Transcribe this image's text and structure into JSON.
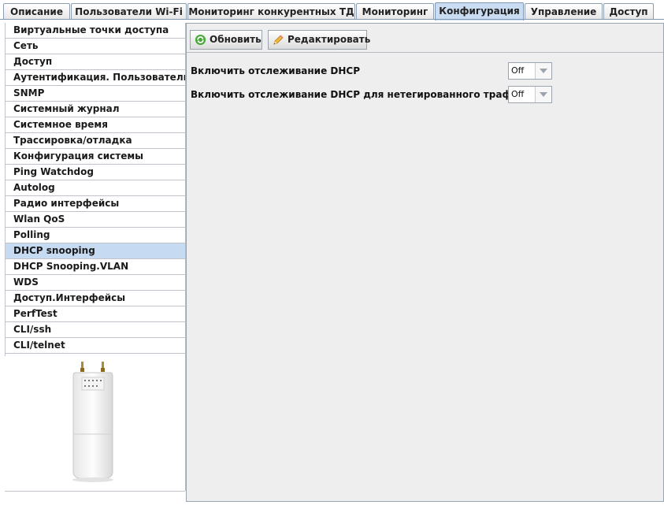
{
  "tabs": [
    {
      "label": "Описание",
      "active": false
    },
    {
      "label": "Пользователи Wi-Fi",
      "active": false
    },
    {
      "label": "Мониторинг конкурентных ТД",
      "active": false
    },
    {
      "label": "Мониторинг",
      "active": false
    },
    {
      "label": "Конфигурация",
      "active": true
    },
    {
      "label": "Управление",
      "active": false
    },
    {
      "label": "Доступ",
      "active": false
    }
  ],
  "sidebar": {
    "items": [
      {
        "label": "Виртуальные точки доступа"
      },
      {
        "label": "Сеть"
      },
      {
        "label": "Доступ"
      },
      {
        "label": "Аутентификация. Пользователи"
      },
      {
        "label": "SNMP"
      },
      {
        "label": "Системный журнал"
      },
      {
        "label": "Системное время"
      },
      {
        "label": "Трассировка/отладка"
      },
      {
        "label": "Конфигурация системы"
      },
      {
        "label": "Ping Watchdog"
      },
      {
        "label": "Autolog"
      },
      {
        "label": "Радио интерфейсы"
      },
      {
        "label": "Wlan QoS"
      },
      {
        "label": "Polling"
      },
      {
        "label": "DHCP snooping",
        "selected": true
      },
      {
        "label": "DHCP Snooping.VLAN"
      },
      {
        "label": "WDS"
      },
      {
        "label": "Доступ.Интерфейсы"
      },
      {
        "label": "PerfTest"
      },
      {
        "label": "CLI/ssh"
      },
      {
        "label": "CLI/telnet"
      }
    ]
  },
  "toolbar": {
    "refresh_label": "Обновить",
    "edit_label": "Редактировать",
    "refresh_icon": "refresh-icon",
    "edit_icon": "pencil-icon"
  },
  "settings": [
    {
      "label": "Включить отслеживание DHCP",
      "value": "Off"
    },
    {
      "label": "Включить отслеживание DHCP для нетегированного трафика",
      "value": "Off"
    }
  ],
  "colors": {
    "selected_bg": "#c6dbf2",
    "active_tab_bg": "#c9dcf2",
    "panel_bg": "#eeeeee"
  }
}
